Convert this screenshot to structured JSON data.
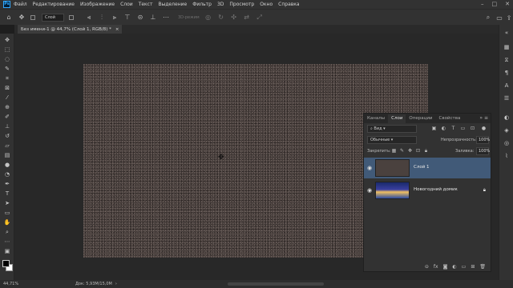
{
  "app": {
    "logo": "Ps"
  },
  "menu": [
    "Файл",
    "Редактирование",
    "Изображение",
    "Слои",
    "Текст",
    "Выделение",
    "Фильтр",
    "3D",
    "Просмотр",
    "Окно",
    "Справка"
  ],
  "options_bar": {
    "auto_select_target": "Слой",
    "mode_3d": "3D-режим"
  },
  "document": {
    "tab_title": "Без имени-1 @ 44,7% (Слой 1, RGB/8) *",
    "close_symbol": "×"
  },
  "status": {
    "zoom": "44,71%",
    "doc_size": "Док: 5,93M/15,0M"
  },
  "layers_panel": {
    "tabs": [
      "Каналы",
      "Слои",
      "Операции",
      "Свойства"
    ],
    "active_tab": "Слои",
    "filter_kind": "Вид",
    "blend_mode": "Обычные",
    "opacity_label": "Непрозрачность:",
    "opacity_value": "100%",
    "lock_label": "Закрепить:",
    "fill_label": "Заливка:",
    "fill_value": "100%",
    "layers": [
      {
        "name": "Слой 1",
        "selected": true,
        "locked": false
      },
      {
        "name": "Новогодний домик",
        "selected": false,
        "locked": true
      }
    ]
  },
  "colors": {
    "selected_layer": "#415a78",
    "canvas": "#4a413e",
    "ps_blue": "#31a8ff"
  },
  "icons": {
    "tools": [
      "move-icon",
      "artboard-icon",
      "marquee-icon",
      "lasso-icon",
      "quick-select-icon",
      "crop-icon",
      "frame-icon",
      "eyedropper-icon",
      "healing-icon",
      "brush-icon",
      "clone-stamp-icon",
      "history-brush-icon",
      "eraser-icon",
      "gradient-icon",
      "blur-icon",
      "dodge-icon",
      "pen-icon",
      "type-icon",
      "path-select-icon",
      "rectangle-icon",
      "hand-icon",
      "zoom-icon",
      "more-tools-icon"
    ],
    "right_strip": [
      "arrange-icon",
      "history-icon",
      "paragraph-icon",
      "character-icon",
      "properties-icon",
      "adjustments-icon",
      "layers-icon",
      "channels-icon",
      "paths-icon"
    ]
  }
}
